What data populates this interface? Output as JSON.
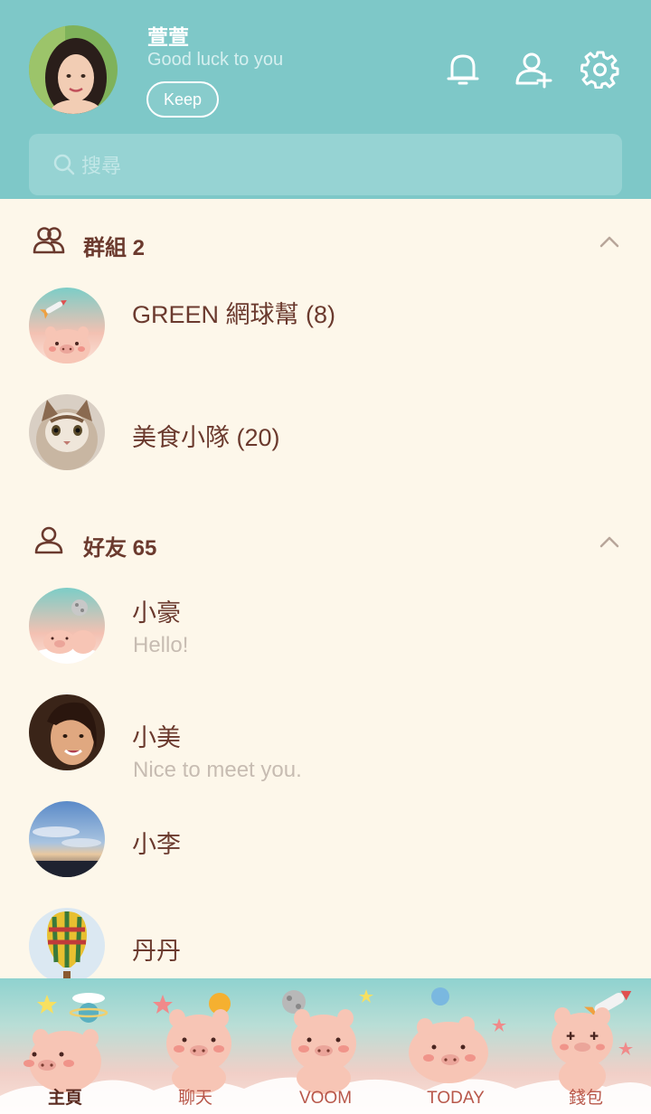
{
  "profile": {
    "name": "萱萱",
    "status": "Good luck to you",
    "keep_label": "Keep"
  },
  "search": {
    "placeholder": "搜尋"
  },
  "groups": {
    "title": "群組 2",
    "items": [
      {
        "name": "GREEN 網球幫 (8)"
      },
      {
        "name": "美食小隊 (20)"
      }
    ]
  },
  "friends": {
    "title": "好友 65",
    "items": [
      {
        "name": "小豪",
        "message": "Hello!"
      },
      {
        "name": "小美",
        "message": "Nice to meet you."
      },
      {
        "name": "小李"
      },
      {
        "name": "丹丹"
      }
    ]
  },
  "tabs": [
    {
      "label": "主頁",
      "active": true
    },
    {
      "label": "聊天"
    },
    {
      "label": "VOOM"
    },
    {
      "label": "TODAY"
    },
    {
      "label": "錢包"
    }
  ],
  "colors": {
    "header": "#7ec8c8",
    "background": "#fdf7ea",
    "text_primary": "#6b3a2e",
    "text_secondary": "#c7bcb2"
  },
  "icons": [
    "bell-icon",
    "add-friend-icon",
    "settings-icon",
    "search-icon",
    "group-icon",
    "friend-icon",
    "chevron-up-icon"
  ]
}
